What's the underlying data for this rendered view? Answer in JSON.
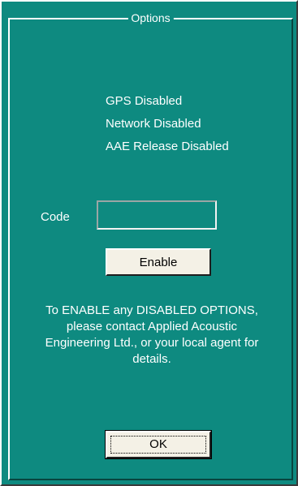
{
  "dialog": {
    "group_title": "Options",
    "status": [
      "GPS Disabled",
      "Network Disabled",
      "AAE Release Disabled"
    ],
    "code_label": "Code",
    "code_value": "",
    "enable_label": "Enable",
    "info_lines": [
      "To ENABLE any DISABLED OPTIONS,",
      "please contact Applied Acoustic",
      "Engineering Ltd., or your local agent for",
      "details."
    ],
    "ok_label": "OK"
  },
  "colors": {
    "background": "#0e8a80",
    "text": "#ffffff",
    "button_face": "#f4f1e6"
  }
}
